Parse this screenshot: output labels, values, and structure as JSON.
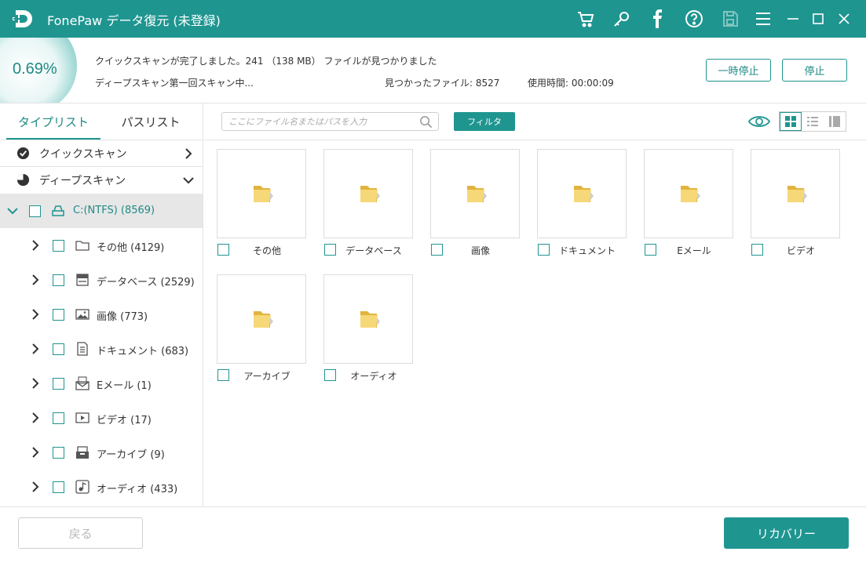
{
  "app": {
    "title": "FonePaw データ復元 (未登録)"
  },
  "colors": {
    "accent": "#1f9590",
    "folder": "#f2cc5a"
  },
  "titlebar_icons": [
    "cart-icon",
    "key-icon",
    "facebook-icon",
    "help-icon",
    "save-icon",
    "menu-icon",
    "minimize-icon",
    "maximize-icon",
    "close-icon"
  ],
  "status": {
    "progress": "0.69%",
    "line1": "クイックスキャンが完了しました。241 （138 MB） ファイルが見つかりました",
    "line2": "ディープスキャン第一回スキャン中...",
    "found": "見つかったファイル: 8527",
    "elapsed": "使用時間: 00:00:09",
    "pause_label": "一時停止",
    "stop_label": "停止"
  },
  "sidebar": {
    "tabs": [
      {
        "label": "タイプリスト"
      },
      {
        "label": "パスリスト"
      }
    ],
    "quick_scan": "クイックスキャン",
    "deep_scan": "ディープスキャン",
    "drive": "C:(NTFS) (8569)",
    "items": [
      {
        "label": "その他 (4129)",
        "icon": "folder-icon"
      },
      {
        "label": "データベース (2529)",
        "icon": "database-icon"
      },
      {
        "label": "画像 (773)",
        "icon": "image-icon"
      },
      {
        "label": "ドキュメント (683)",
        "icon": "document-icon"
      },
      {
        "label": "Eメール (1)",
        "icon": "email-icon"
      },
      {
        "label": "ビデオ (17)",
        "icon": "video-icon"
      },
      {
        "label": "アーカイブ (9)",
        "icon": "archive-icon"
      },
      {
        "label": "オーディオ (433)",
        "icon": "audio-icon"
      }
    ]
  },
  "toolbar": {
    "search_placeholder": "ここにファイル名またはパスを入力",
    "filter_label": "フィルタ"
  },
  "grid": {
    "items": [
      {
        "label": "その他"
      },
      {
        "label": "データベース"
      },
      {
        "label": "画像"
      },
      {
        "label": "ドキュメント"
      },
      {
        "label": "Eメール"
      },
      {
        "label": "ビデオ"
      },
      {
        "label": "アーカイブ"
      },
      {
        "label": "オーディオ"
      }
    ]
  },
  "footer": {
    "back_label": "戻る",
    "recover_label": "リカバリー"
  }
}
